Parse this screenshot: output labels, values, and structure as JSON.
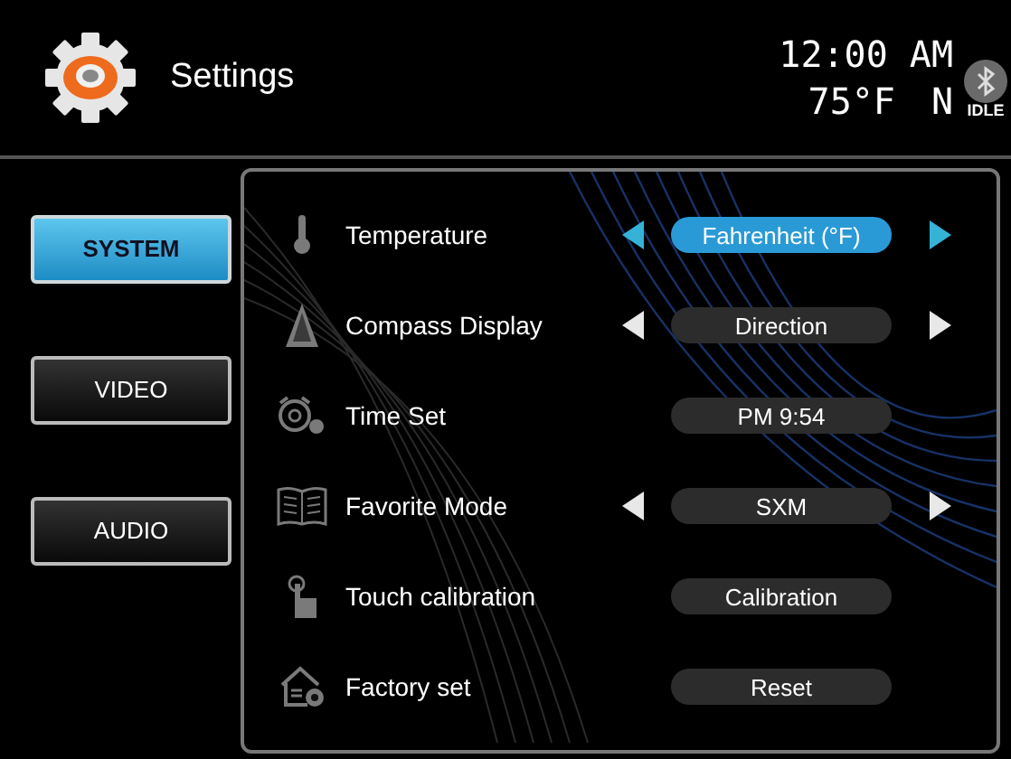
{
  "header": {
    "title": "Settings",
    "time": "12:00 AM",
    "temperature": "75°F",
    "heading": "N",
    "bluetooth_status": "IDLE"
  },
  "tabs": [
    {
      "label": "SYSTEM",
      "selected": true
    },
    {
      "label": "VIDEO",
      "selected": false
    },
    {
      "label": "AUDIO",
      "selected": false
    }
  ],
  "settings": [
    {
      "kind": "selector",
      "label": "Temperature",
      "value": "Fahrenheit (°F)",
      "selected": true
    },
    {
      "kind": "selector",
      "label": "Compass Display",
      "value": "Direction",
      "selected": false
    },
    {
      "kind": "button",
      "label": "Time Set",
      "value": "PM 9:54",
      "selected": false
    },
    {
      "kind": "selector",
      "label": "Favorite Mode",
      "value": "SXM",
      "selected": false
    },
    {
      "kind": "button",
      "label": "Touch calibration",
      "value": "Calibration",
      "selected": false
    },
    {
      "kind": "button",
      "label": "Factory set",
      "value": "Reset",
      "selected": false
    }
  ]
}
